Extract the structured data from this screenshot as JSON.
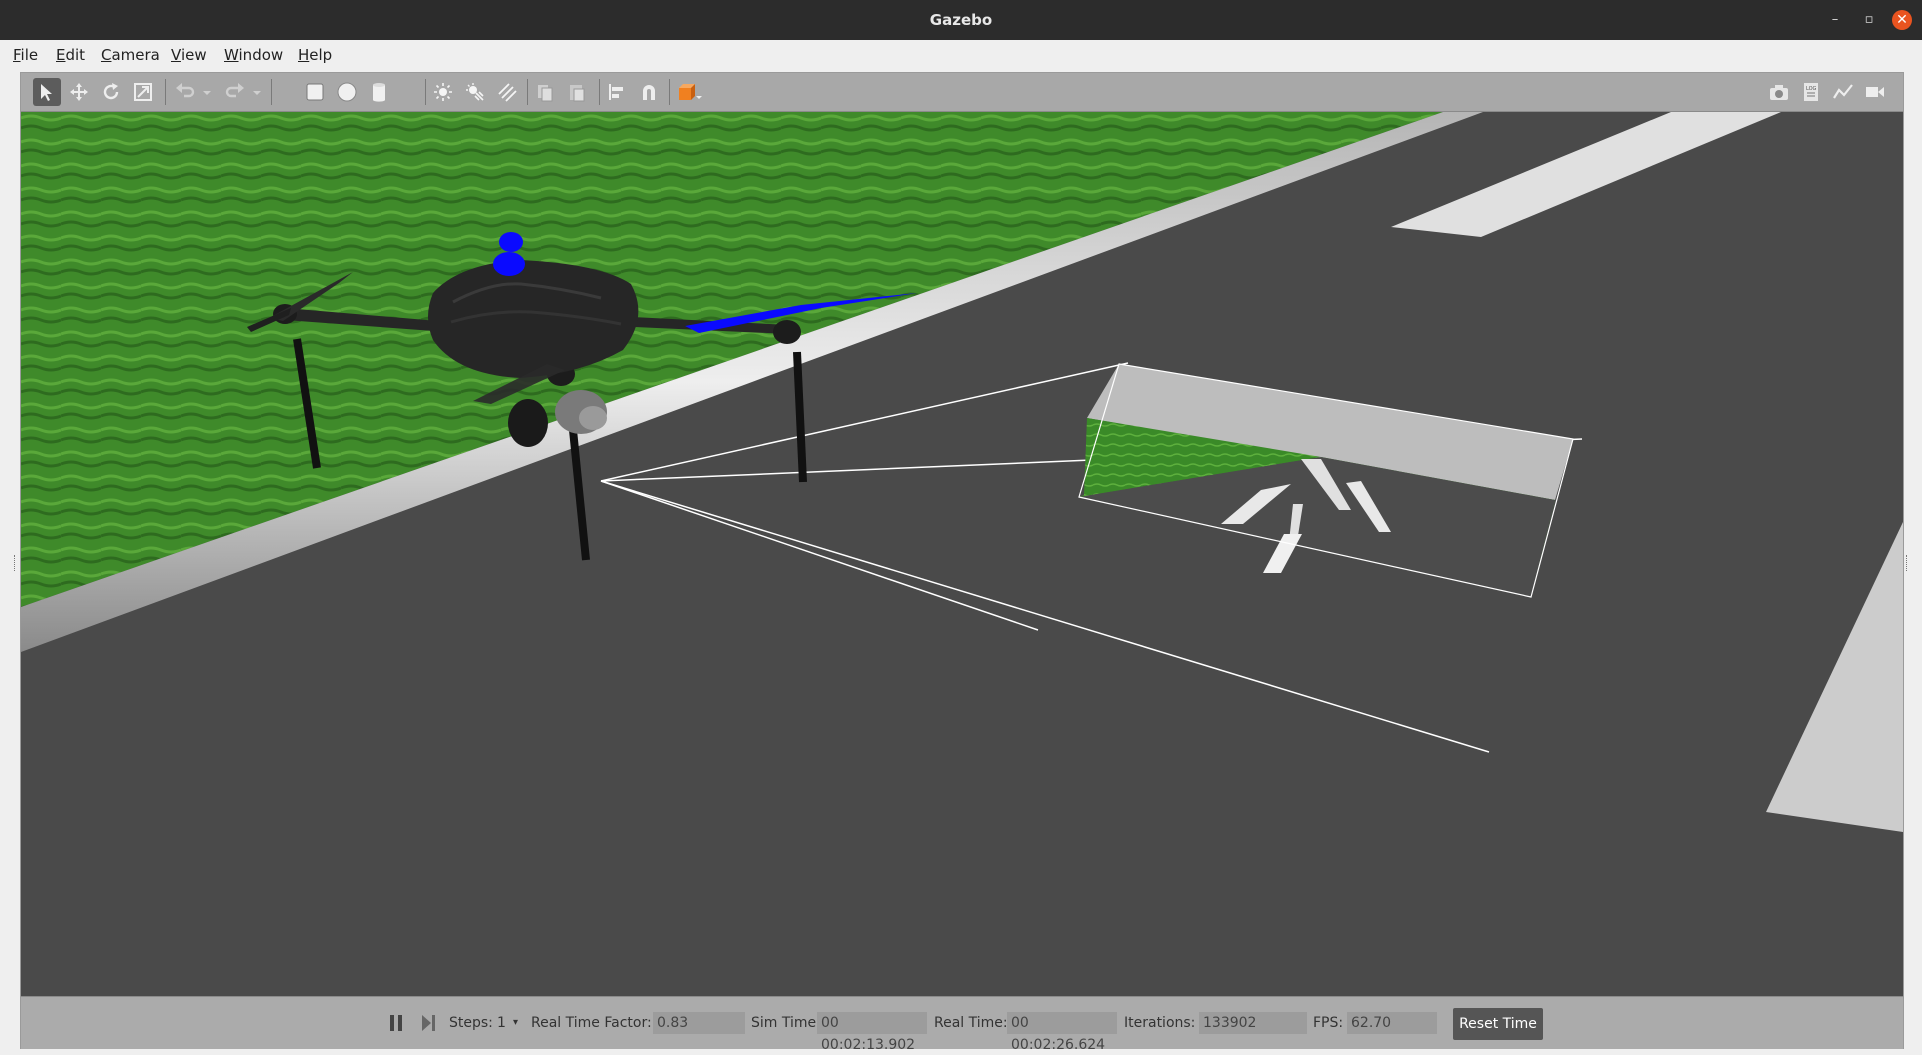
{
  "window": {
    "title": "Gazebo"
  },
  "menu": {
    "items": [
      "File",
      "Edit",
      "Camera",
      "View",
      "Window",
      "Help"
    ]
  },
  "toolbar": {
    "left_tools": [
      "select-arrow-icon",
      "translate-icon",
      "rotate-icon",
      "scale-icon",
      "undo-icon",
      "dropdown-arrow-icon",
      "redo-icon",
      "dropdown-arrow-icon",
      "box-shape-icon",
      "sphere-shape-icon",
      "cylinder-shape-icon",
      "point-light-icon",
      "spot-light-icon",
      "directional-light-icon",
      "copy-icon",
      "paste-icon",
      "align-icon",
      "snap-magnet-icon",
      "view-angle-icon"
    ],
    "right_tools": [
      "screenshot-camera-icon",
      "log-icon",
      "plot-icon",
      "video-record-icon"
    ]
  },
  "bottom_bar": {
    "steps_label": "Steps:",
    "steps_value": "1",
    "real_time_factor_label": "Real Time Factor:",
    "real_time_factor_value": "0.83",
    "sim_time_label": "Sim Time:",
    "sim_time_value": "00 00:02:13.902",
    "real_time_label": "Real Time:",
    "real_time_value": "00 00:02:26.624",
    "iterations_label": "Iterations:",
    "iterations_value": "133902",
    "fps_label": "FPS:",
    "fps_value": "62.70",
    "reset_time_label": "Reset Time"
  },
  "colors": {
    "grass": "#3f8a2a",
    "asphalt": "#4a4a4a",
    "drone_body": "#222222",
    "propeller_blue": "#0a0aff",
    "title_bar": "#2c2c2c",
    "close_button": "#e95420",
    "view_angle_accent": "#f08020"
  }
}
